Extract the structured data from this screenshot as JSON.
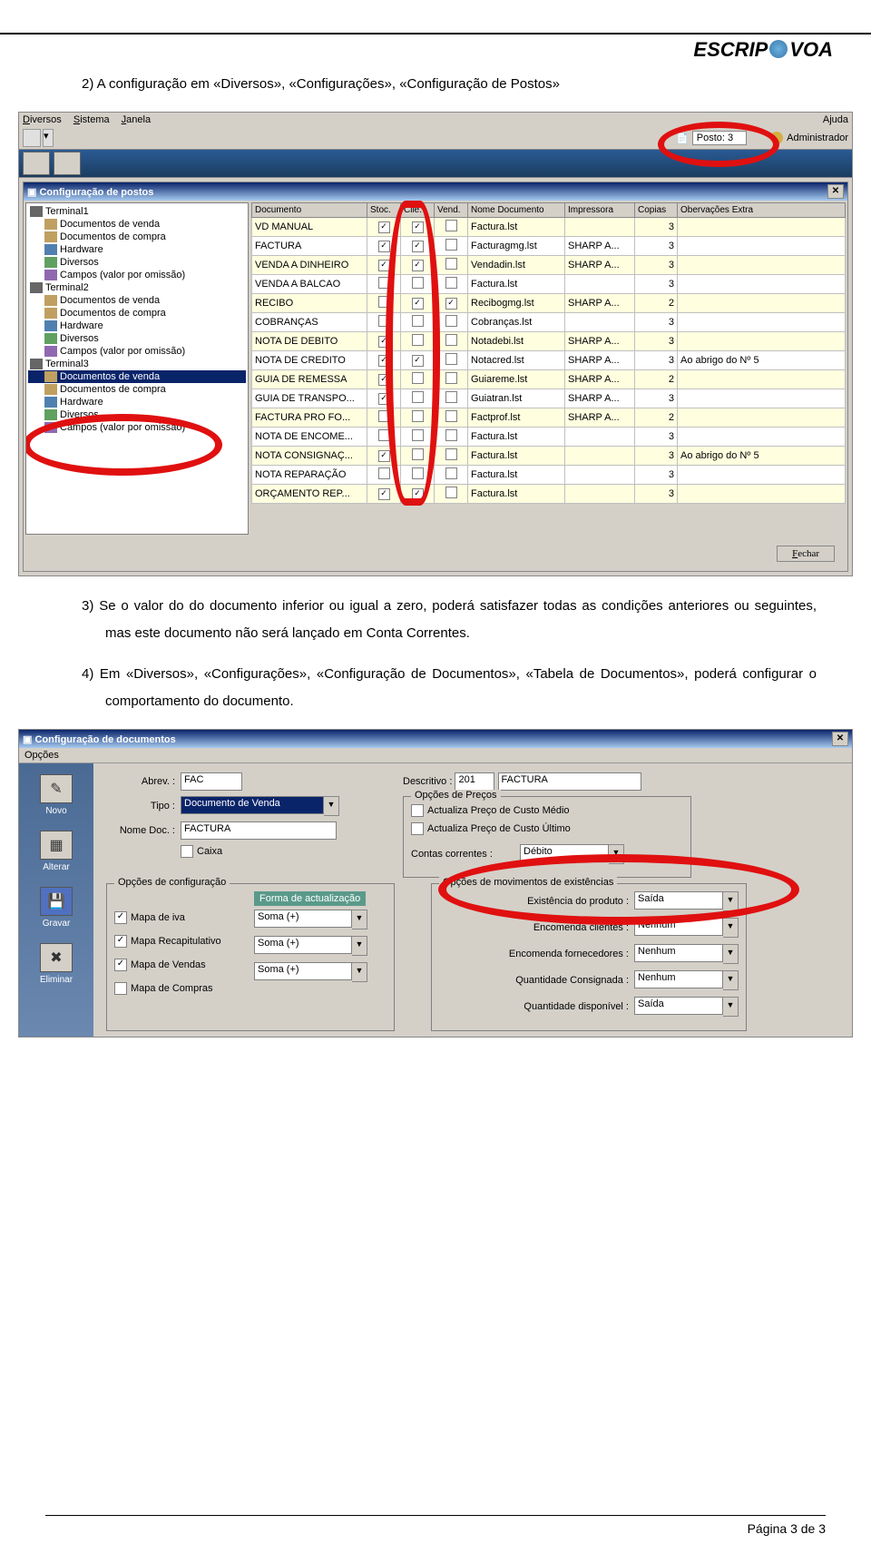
{
  "logo": {
    "part1": "ESCRIP",
    "part2": "VOA"
  },
  "text": {
    "line_2": "2)  A configuração em «Diversos», «Configurações», «Configuração de Postos»",
    "line_3": "3)  Se o valor do do documento inferior ou igual a zero, poderá satisfazer todas as condições anteriores ou seguintes, mas este documento não será lançado em Conta Correntes.",
    "line_4": "4)  Em «Diversos», «Configurações», «Configuração de Documentos»,  «Tabela de Documentos», poderá configurar o comportamento do documento."
  },
  "app": {
    "menu": {
      "diversos": "Diversos",
      "sistema": "Sistema",
      "janela": "Janela",
      "ajuda": "Ajuda"
    },
    "toolbar": {
      "posto": "Posto:  3",
      "admin": "Administrador"
    },
    "win": {
      "title": "Configuração de postos",
      "close": "Fechar"
    },
    "tree": {
      "t1": "Terminal1",
      "t2": "Terminal2",
      "t3": "Terminal3",
      "dv": "Documentos de venda",
      "dc": "Documentos de compra",
      "hw": "Hardware",
      "di": "Diversos",
      "ca": "Campos (valor por omissão)"
    },
    "cols": {
      "doc": "Documento",
      "sto": "Stoc.",
      "cli": "Clie.",
      "ven": "Vend.",
      "nom": "Nome Documento",
      "imp": "Impressora",
      "cop": "Copias",
      "obs": "Obervações Extra"
    },
    "rows": [
      {
        "doc": "VD MANUAL",
        "s": 1,
        "c": 1,
        "v": 0,
        "nom": "Factura.lst",
        "imp": "",
        "cop": "3",
        "obs": ""
      },
      {
        "doc": "FACTURA",
        "s": 1,
        "c": 1,
        "v": 0,
        "nom": "Facturagmg.lst",
        "imp": "SHARP A...",
        "cop": "3",
        "obs": ""
      },
      {
        "doc": "VENDA A DINHEIRO",
        "s": 1,
        "c": 1,
        "v": 0,
        "nom": "Vendadin.lst",
        "imp": "SHARP A...",
        "cop": "3",
        "obs": ""
      },
      {
        "doc": "VENDA A BALCAO",
        "s": 0,
        "c": 0,
        "v": 0,
        "nom": "Factura.lst",
        "imp": "",
        "cop": "3",
        "obs": ""
      },
      {
        "doc": "RECIBO",
        "s": 0,
        "c": 1,
        "v": 1,
        "nom": "Recibogmg.lst",
        "imp": "SHARP A...",
        "cop": "2",
        "obs": ""
      },
      {
        "doc": "COBRANÇAS",
        "s": 0,
        "c": 0,
        "v": 0,
        "nom": "Cobranças.lst",
        "imp": "",
        "cop": "3",
        "obs": ""
      },
      {
        "doc": "NOTA DE DEBITO",
        "s": 1,
        "c": 0,
        "v": 0,
        "nom": "Notadebi.lst",
        "imp": "SHARP A...",
        "cop": "3",
        "obs": ""
      },
      {
        "doc": "NOTA DE CREDITO",
        "s": 1,
        "c": 1,
        "v": 0,
        "nom": "Notacred.lst",
        "imp": "SHARP A...",
        "cop": "3",
        "obs": "Ao abrigo do Nº 5"
      },
      {
        "doc": "GUIA DE REMESSA",
        "s": 1,
        "c": 0,
        "v": 0,
        "nom": "Guiareme.lst",
        "imp": "SHARP A...",
        "cop": "2",
        "obs": ""
      },
      {
        "doc": "GUIA DE TRANSPO...",
        "s": 1,
        "c": 0,
        "v": 0,
        "nom": "Guiatran.lst",
        "imp": "SHARP A...",
        "cop": "3",
        "obs": ""
      },
      {
        "doc": "FACTURA PRO FO...",
        "s": 0,
        "c": 0,
        "v": 0,
        "nom": "Factprof.lst",
        "imp": "SHARP A...",
        "cop": "2",
        "obs": ""
      },
      {
        "doc": "NOTA DE ENCOME...",
        "s": 0,
        "c": 0,
        "v": 0,
        "nom": "Factura.lst",
        "imp": "",
        "cop": "3",
        "obs": ""
      },
      {
        "doc": "NOTA CONSIGNAÇ...",
        "s": 1,
        "c": 0,
        "v": 0,
        "nom": "Factura.lst",
        "imp": "",
        "cop": "3",
        "obs": "Ao abrigo do Nº 5"
      },
      {
        "doc": "NOTA REPARAÇÃO",
        "s": 0,
        "c": 0,
        "v": 0,
        "nom": "Factura.lst",
        "imp": "",
        "cop": "3",
        "obs": ""
      },
      {
        "doc": "ORÇAMENTO REP...",
        "s": 1,
        "c": 1,
        "v": 0,
        "nom": "Factura.lst",
        "imp": "",
        "cop": "3",
        "obs": ""
      }
    ]
  },
  "d2": {
    "title": "Configuração de documentos",
    "opcoes": "Opções",
    "sidebar": {
      "novo": "Novo",
      "alterar": "Alterar",
      "gravar": "Gravar",
      "eliminar": "Eliminar"
    },
    "labels": {
      "abrev": "Abrev. :",
      "tipo": "Tipo :",
      "nome": "Nome Doc. :",
      "descritivo": "Descritivo :",
      "caixa": "Caixa",
      "opcfg": "Opções de configuração",
      "forma": "Forma de actualização",
      "mapiva": "Mapa de iva",
      "maprec": "Mapa Recapitulativo",
      "mapven": "Mapa de Vendas",
      "mapcom": "Mapa de Compras",
      "opprecos": "Opções de  Preços",
      "act1": "Actualiza Preço de Custo Médio",
      "act2": "Actualiza Preço de Custo Último",
      "contas": "Contas correntes :",
      "opmov": "Opções de movimentos de existências",
      "exist": "Existência do produto :",
      "enccli": "Encomenda clientes :",
      "encfor": "Encomenda fornecedores :",
      "qtcon": "Quantidade Consignada :",
      "qtdis": "Quantidade disponível :"
    },
    "values": {
      "abrev": "FAC",
      "tipo": "Documento de Venda",
      "nome": "FACTURA",
      "desc_num": "201",
      "desc_txt": "FACTURA",
      "soma": "Soma (+)",
      "debito": "Débito",
      "saida": "Saída",
      "nenhum": "Nenhum"
    }
  },
  "footer": "Página 3 de 3"
}
